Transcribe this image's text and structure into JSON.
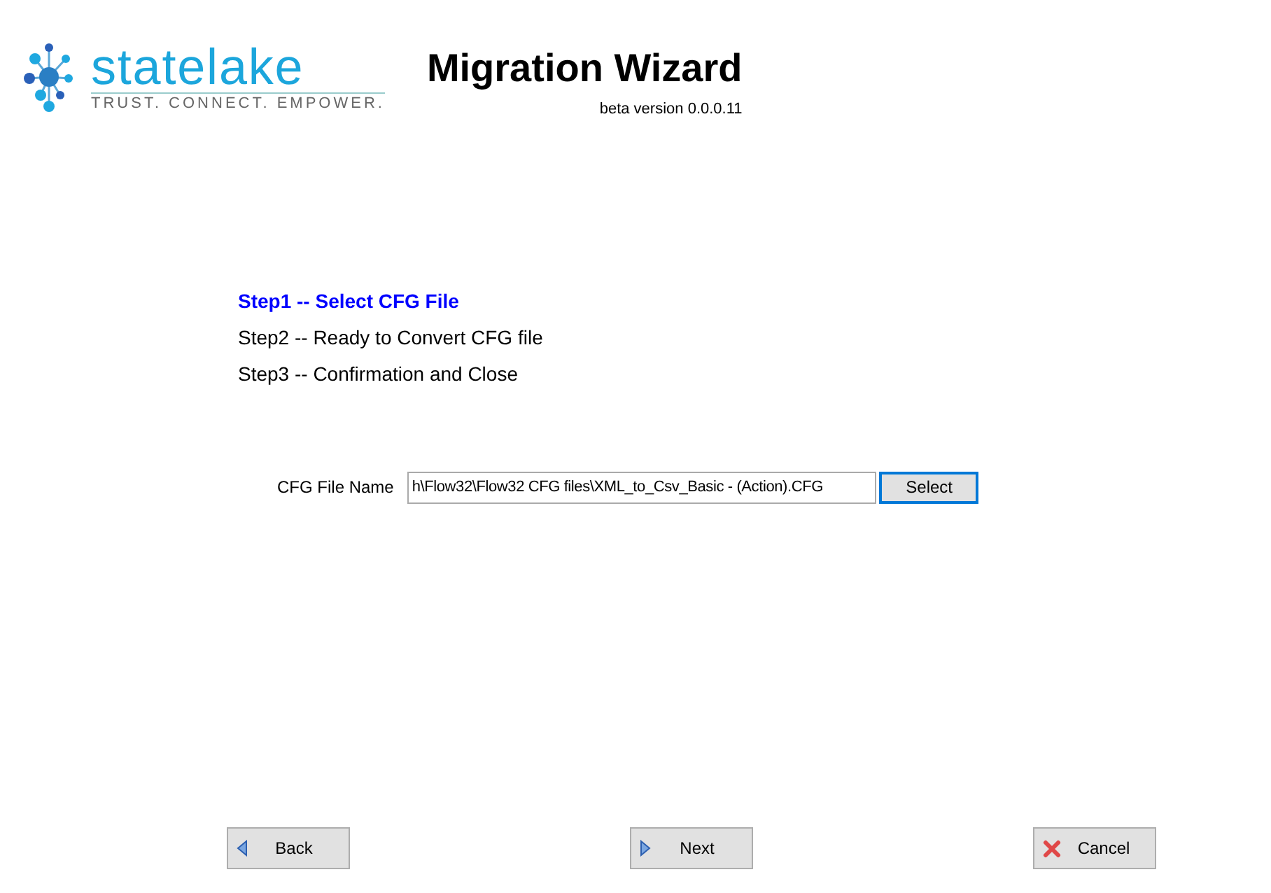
{
  "logo": {
    "name": "statelake",
    "tagline": "TRUST. CONNECT. EMPOWER."
  },
  "title": "Migration Wizard",
  "version": "beta version 0.0.0.11",
  "steps": [
    {
      "label": "Step1 -- Select CFG File",
      "selected": true
    },
    {
      "label": "Step2 -- Ready to Convert CFG file",
      "selected": false
    },
    {
      "label": "Step3 -- Confirmation and Close",
      "selected": false
    }
  ],
  "file": {
    "label": "CFG File Name",
    "value": "h\\Flow32\\Flow32 CFG files\\XML_to_Csv_Basic - (Action).CFG",
    "button": "Select"
  },
  "buttons": [
    {
      "kind": "back",
      "label": "Back"
    },
    {
      "kind": "next",
      "label": "Next"
    },
    {
      "kind": "cancel",
      "label": "Cancel"
    }
  ]
}
